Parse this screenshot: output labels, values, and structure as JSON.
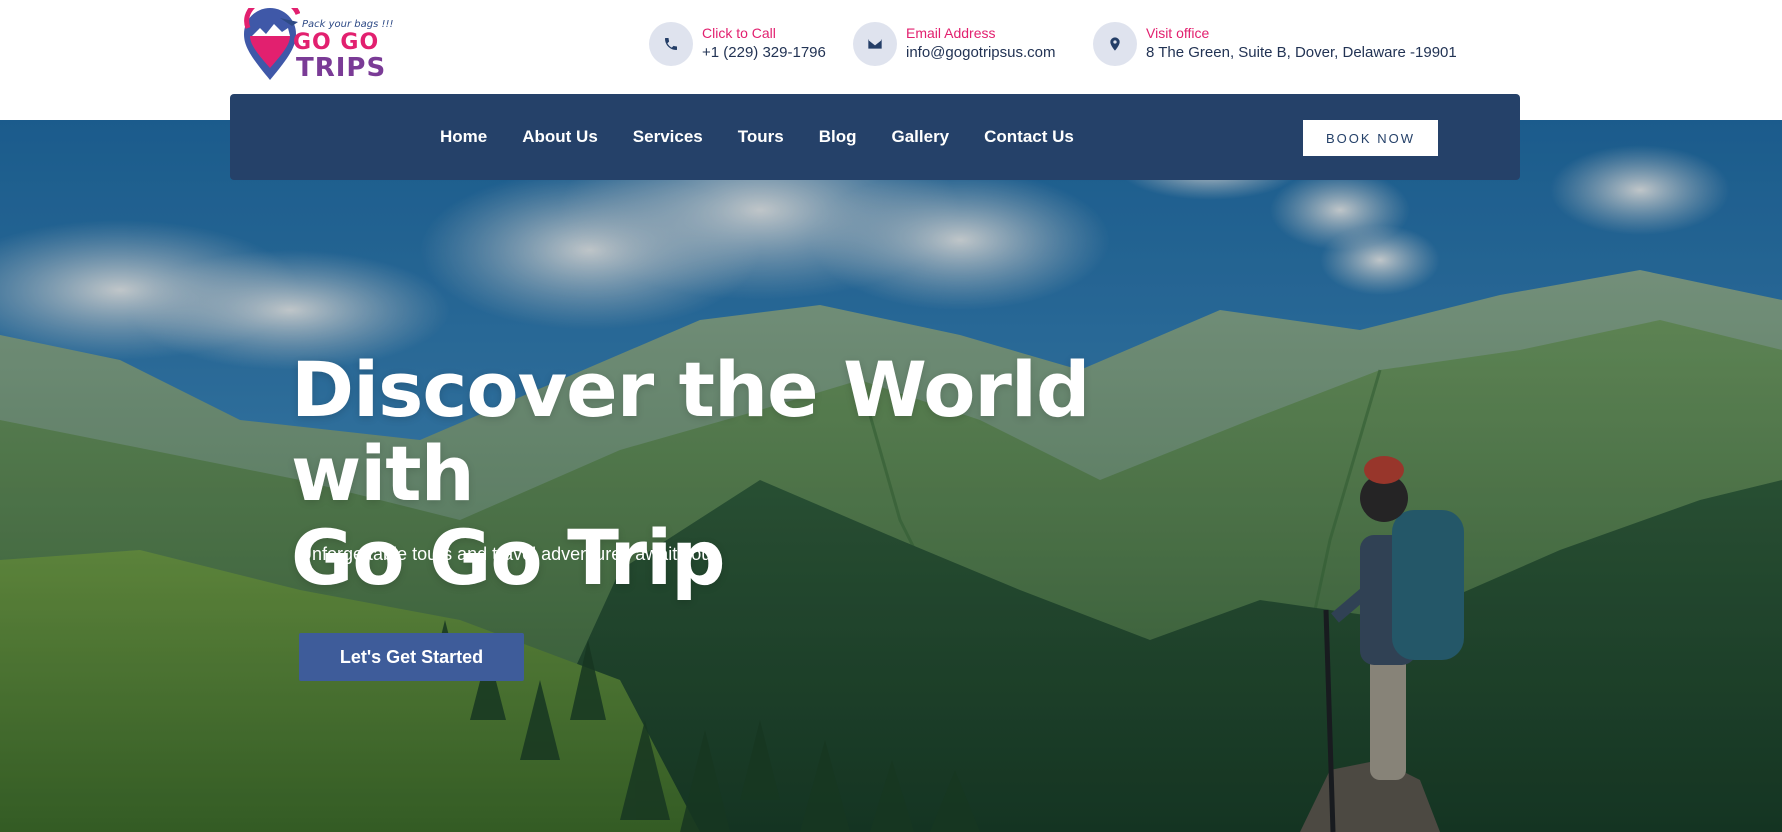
{
  "brand": {
    "tagline": "Pack your bags !!!",
    "word_top": "GO GO",
    "word_bottom": "TRIPS",
    "colors": {
      "pink": "#e2206f",
      "purple": "#7a3b96",
      "navy": "#254169"
    }
  },
  "contacts": [
    {
      "icon": "phone-icon",
      "label": "Click to Call",
      "value": "+1 (229) 329-1796"
    },
    {
      "icon": "envelope-icon",
      "label": "Email Address",
      "value": "info@gogotripsus.com"
    },
    {
      "icon": "map-pin-icon",
      "label": "Visit office",
      "value": "8 The Green, Suite B, Dover, Delaware -19901"
    }
  ],
  "nav": {
    "items": [
      {
        "label": "Home"
      },
      {
        "label": "About Us"
      },
      {
        "label": "Services"
      },
      {
        "label": "Tours"
      },
      {
        "label": "Blog"
      },
      {
        "label": "Gallery"
      },
      {
        "label": "Contact Us"
      }
    ],
    "book_label": "BOOK NOW"
  },
  "hero": {
    "title_line1": "Discover the World with",
    "title_line2": "Go Go Trip",
    "subtitle": "Unforgettable tours and travel adventures await you.",
    "cta_label": "Let's Get Started"
  }
}
